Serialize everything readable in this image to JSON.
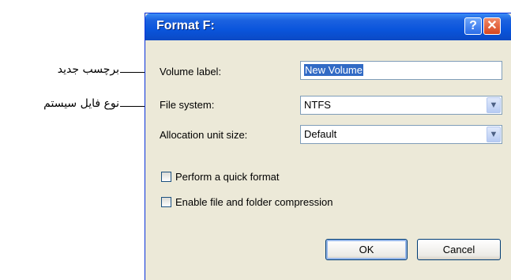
{
  "annotations": {
    "volume_label_note": "برچسب جدید",
    "file_system_note": "نوع فایل سیستم"
  },
  "dialog": {
    "title": "Format F:",
    "help_button": "?",
    "close_button": "✕",
    "volume_label": {
      "label": "Volume label:",
      "value": "New Volume"
    },
    "file_system": {
      "label": "File system:",
      "value": "NTFS"
    },
    "allocation_unit": {
      "label": "Allocation unit size:",
      "value": "Default"
    },
    "quick_format": {
      "label": "Perform a quick format",
      "checked": false
    },
    "compression": {
      "label": "Enable file and folder compression",
      "checked": false
    },
    "ok_button": "OK",
    "cancel_button": "Cancel"
  },
  "colors": {
    "titlebar": "#0a55dc",
    "dialog_bg": "#ece9d8",
    "selection": "#316ac5"
  }
}
